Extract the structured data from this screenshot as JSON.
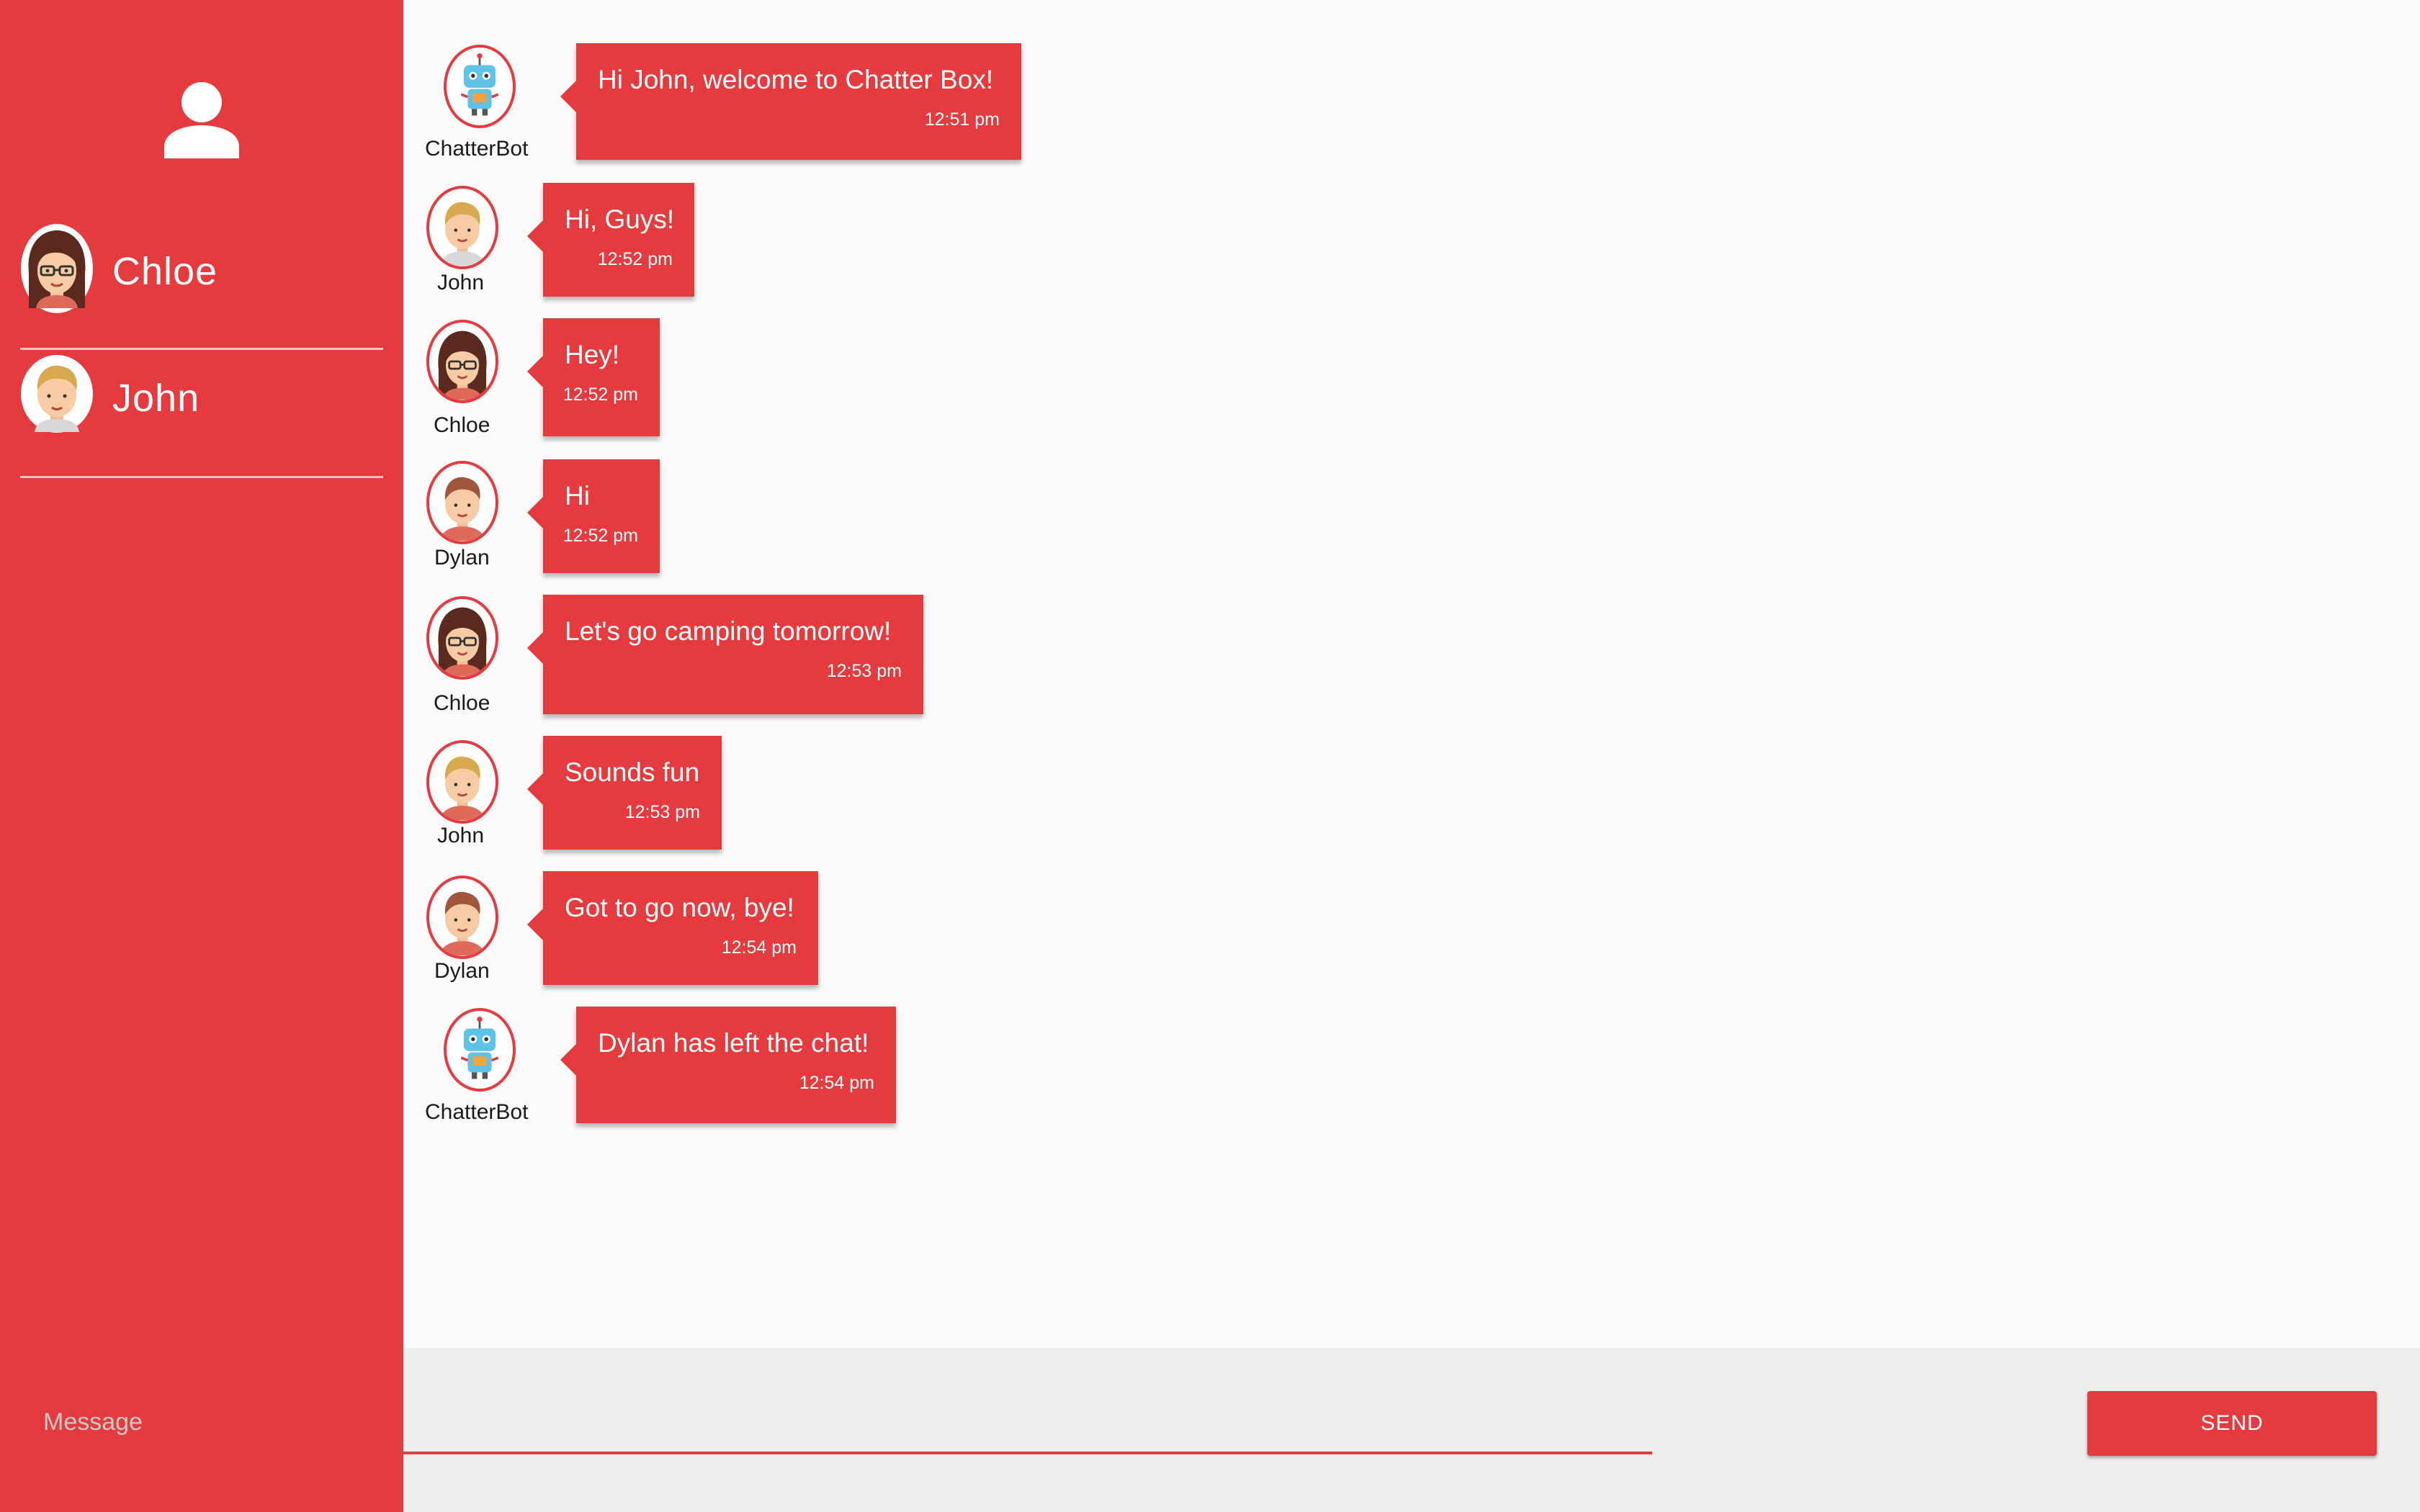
{
  "sidebar": {
    "profile_icon": "person-icon",
    "users": [
      {
        "name": "Chloe",
        "avatar": "woman-glasses-avatar"
      },
      {
        "name": "John",
        "avatar": "blond-man-avatar"
      }
    ]
  },
  "messages": [
    {
      "sender": "ChatterBot",
      "avatar": "robot-avatar",
      "text": "Hi John, welcome to Chatter Box!",
      "time": "12:51 pm"
    },
    {
      "sender": "John",
      "avatar": "blond-man-avatar",
      "text": "Hi, Guys!",
      "time": "12:52 pm"
    },
    {
      "sender": "Chloe",
      "avatar": "woman-glasses-avatar",
      "text": "Hey!",
      "time": "12:52 pm"
    },
    {
      "sender": "Dylan",
      "avatar": "brown-hair-man-avatar",
      "text": "Hi",
      "time": "12:52 pm"
    },
    {
      "sender": "Chloe",
      "avatar": "woman-glasses-avatar",
      "text": "Let's go camping tomorrow!",
      "time": "12:53 pm"
    },
    {
      "sender": "John",
      "avatar": "blond-man-avatar",
      "text": "Sounds fun",
      "time": "12:53 pm"
    },
    {
      "sender": "Dylan",
      "avatar": "brown-hair-man-avatar",
      "text": "Got to go now, bye!",
      "time": "12:54 pm"
    },
    {
      "sender": "ChatterBot",
      "avatar": "robot-avatar",
      "text": "Dylan has left the chat!",
      "time": "12:54 pm"
    }
  ],
  "composer": {
    "placeholder": "Message",
    "value": "",
    "send_label": "SEND"
  },
  "colors": {
    "accent": "#e53b3e",
    "background": "#fafafa",
    "composer_bg": "#efeeee"
  }
}
